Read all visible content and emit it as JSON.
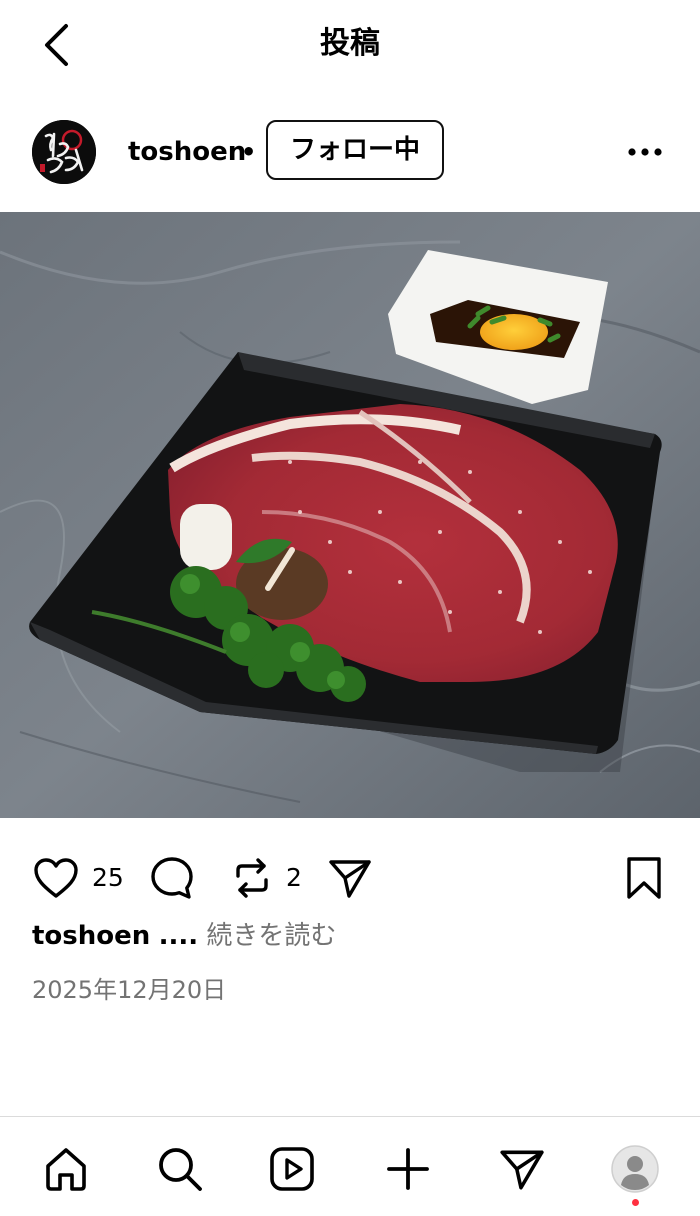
{
  "header": {
    "title": "投稿",
    "back_icon": "chevron-left-icon"
  },
  "post": {
    "username": "toshoen",
    "separator": "•",
    "follow_label": "フォロー中",
    "more_icon": "more-horizontal-icon",
    "avatar_text": "桃松苑"
  },
  "image": {
    "description_icon": "food-photo"
  },
  "actions": {
    "like_count": "25",
    "repost_count": "2"
  },
  "caption": {
    "username": "toshoen",
    "ellipsis": "....",
    "more_label": "続きを読む"
  },
  "date": "2025年12月20日",
  "colors": {
    "text": "#000000",
    "muted": "#737373",
    "divider": "#dbdbdb",
    "notification": "#ff3040"
  }
}
